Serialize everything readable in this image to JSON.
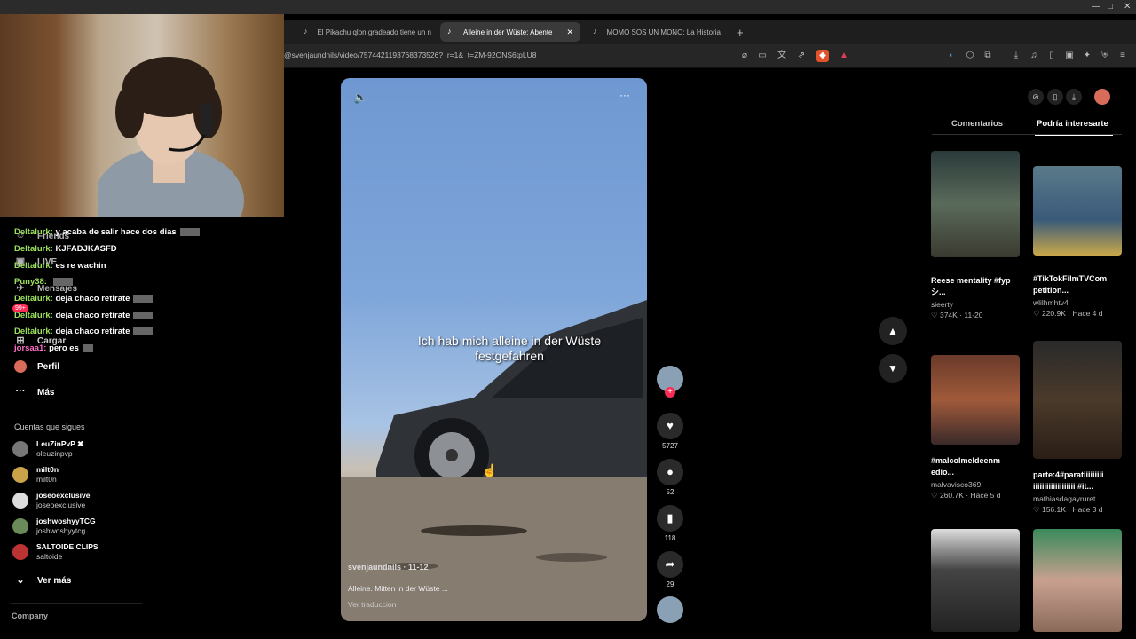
{
  "os": {
    "min": "—",
    "max": "□",
    "close": "✕"
  },
  "tabs": [
    {
      "label": "El Pikachu qlon gradeado tiene un n"
    },
    {
      "label": "Alleine in der Wüste: Abente"
    },
    {
      "label": "MOMO SOS UN MONO: La Historia"
    }
  ],
  "new_tab": "+",
  "url": "@svenjaundnils/video/7574421193768373526?_r=1&_t=ZM-92ONS6tpLU8",
  "chat": [
    {
      "user": "Deltalurk:",
      "msg": "y acaba de salir hace dos dias",
      "emote": true
    },
    {
      "user": "Deltalurk:",
      "msg": "KJFADJKASFD",
      "emote": false
    },
    {
      "user": "Deltalurk:",
      "msg": "es re wachin",
      "emote": false
    },
    {
      "user": "Puny38:",
      "msg": "",
      "emote": true
    },
    {
      "user": "Deltalurk:",
      "msg": "deja chaco retirate",
      "emote": true
    },
    {
      "user": "Deltalurk:",
      "msg": "deja chaco retirate",
      "emote": true
    },
    {
      "user": "Deltalurk:",
      "msg": "deja chaco retirate",
      "emote": true
    },
    {
      "user": "jorsaa1:",
      "msg": "pero es",
      "emote": true
    }
  ],
  "nav": {
    "friends": "Friends",
    "live": "LIVE",
    "messages": "Mensajes",
    "badge": "99+",
    "upload": "Cargar",
    "profile": "Perfil",
    "more": "Más"
  },
  "following": {
    "title": "Cuentas que sigues",
    "accounts": [
      {
        "name": "LeuZinPvP ✖",
        "handle": "oleuzinpvp"
      },
      {
        "name": "milt0n",
        "handle": "milt0n"
      },
      {
        "name": "joseoexclusive",
        "handle": "joseoexclusive"
      },
      {
        "name": "joshwoshyyTCG",
        "handle": "joshwoshyytcg"
      },
      {
        "name": "SALTOIDE CLIPS",
        "handle": "saltoide"
      }
    ],
    "see_more": "Ver más"
  },
  "footer": {
    "company": "Company"
  },
  "video": {
    "caption": "Ich hab mich alleine in der Wüste festgefahren",
    "author": "svenjaundnils · 11-12",
    "desc": "Alleine. Mitten in der Wüste ...",
    "translate": "Ver traducción",
    "likes": "5727",
    "comments": "52",
    "saves": "118",
    "shares": "29"
  },
  "panel": {
    "tab_comments": "Comentarios",
    "tab_related": "Podría interesarte",
    "cards": [
      {
        "title": "Reese mentality #fypシ...",
        "user": "sieerty",
        "stats": "♡ 374K · 11-20"
      },
      {
        "title": "#TikTokFilmTVCom petition...",
        "user": "wlilhmhtv4",
        "stats": "♡ 220.9K · Hace 4 d"
      },
      {
        "title": "#malcolmeldeenm edio...",
        "user": "malvavisco369",
        "stats": "♡ 260.7K · Hace 5 d"
      },
      {
        "title": "parte:4#paratiiiiiiiii iiiiiiiiiiiiiiiiiii #it...",
        "user": "mathiasdagayruret",
        "stats": "♡ 156.1K · Hace 3 d"
      }
    ]
  },
  "colors": {
    "like_red": "#fe2c55",
    "chat_green": "#9be15d"
  }
}
